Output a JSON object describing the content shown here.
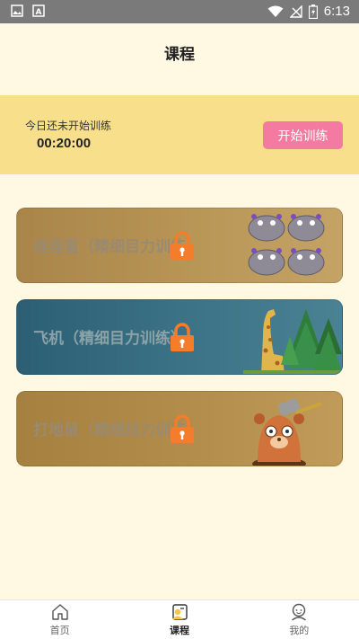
{
  "status_bar": {
    "time": "6:13",
    "left_icons": [
      "image-icon",
      "a-icon"
    ],
    "right_icons": [
      "wifi-icon",
      "no-signal-icon",
      "battery-charging-icon"
    ]
  },
  "header": {
    "title": "课程"
  },
  "training": {
    "label": "今日还未开始训练",
    "timer": "00:20:00",
    "start_label": "开始训练",
    "button_color": "#f57aa1"
  },
  "courses": [
    {
      "title": "连连看（精细目力训练）",
      "locked": true,
      "art": "hippo-icons"
    },
    {
      "title": "飞机（精细目力训练）",
      "locked": true,
      "art": "giraffe-forest"
    },
    {
      "title": "打地鼠（精细目力训练）",
      "locked": true,
      "art": "mole-hammer"
    }
  ],
  "nav": {
    "items": [
      {
        "label": "首页",
        "icon": "home-icon",
        "active": false
      },
      {
        "label": "课程",
        "icon": "course-icon",
        "active": true
      },
      {
        "label": "我的",
        "icon": "profile-icon",
        "active": false
      }
    ]
  },
  "colors": {
    "page_bg": "#fff8e2",
    "banner_bg": "#f8df8c",
    "lock": "#f47c2a"
  }
}
